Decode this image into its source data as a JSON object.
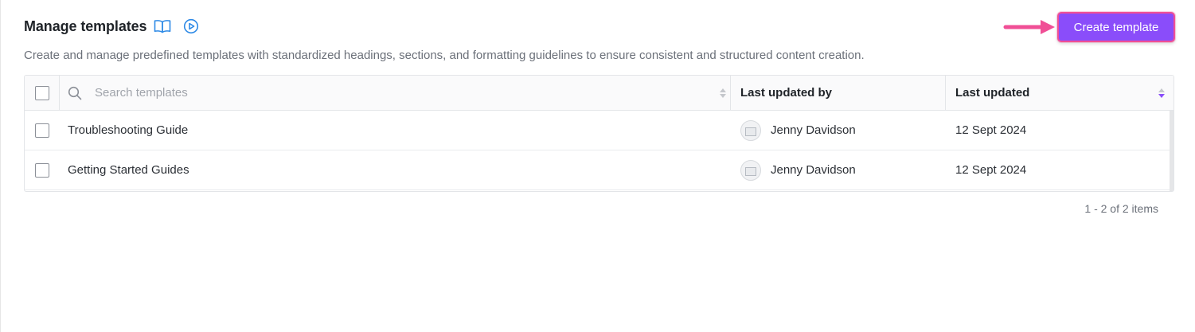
{
  "header": {
    "title": "Manage templates",
    "subtitle": "Create and manage predefined templates with standardized headings, sections, and formatting guidelines to ensure consistent and structured content creation."
  },
  "actions": {
    "create_label": "Create template"
  },
  "colors": {
    "accent": "#8a4dfa",
    "highlight": "#f04f96",
    "link_icon": "#2e8ae6"
  },
  "icons": {
    "guide": "book-icon",
    "video": "play-circle-icon",
    "search": "search-icon",
    "sort": "sort-icon"
  },
  "table": {
    "search_placeholder": "Search templates",
    "columns": {
      "updated_by": "Last updated by",
      "updated": "Last updated"
    },
    "rows": [
      {
        "name": "Troubleshooting Guide",
        "user": "Jenny Davidson",
        "date": "12 Sept 2024"
      },
      {
        "name": "Getting Started Guides",
        "user": "Jenny Davidson",
        "date": "12 Sept 2024"
      }
    ]
  },
  "pagination": {
    "summary": "1 - 2 of 2 items"
  }
}
